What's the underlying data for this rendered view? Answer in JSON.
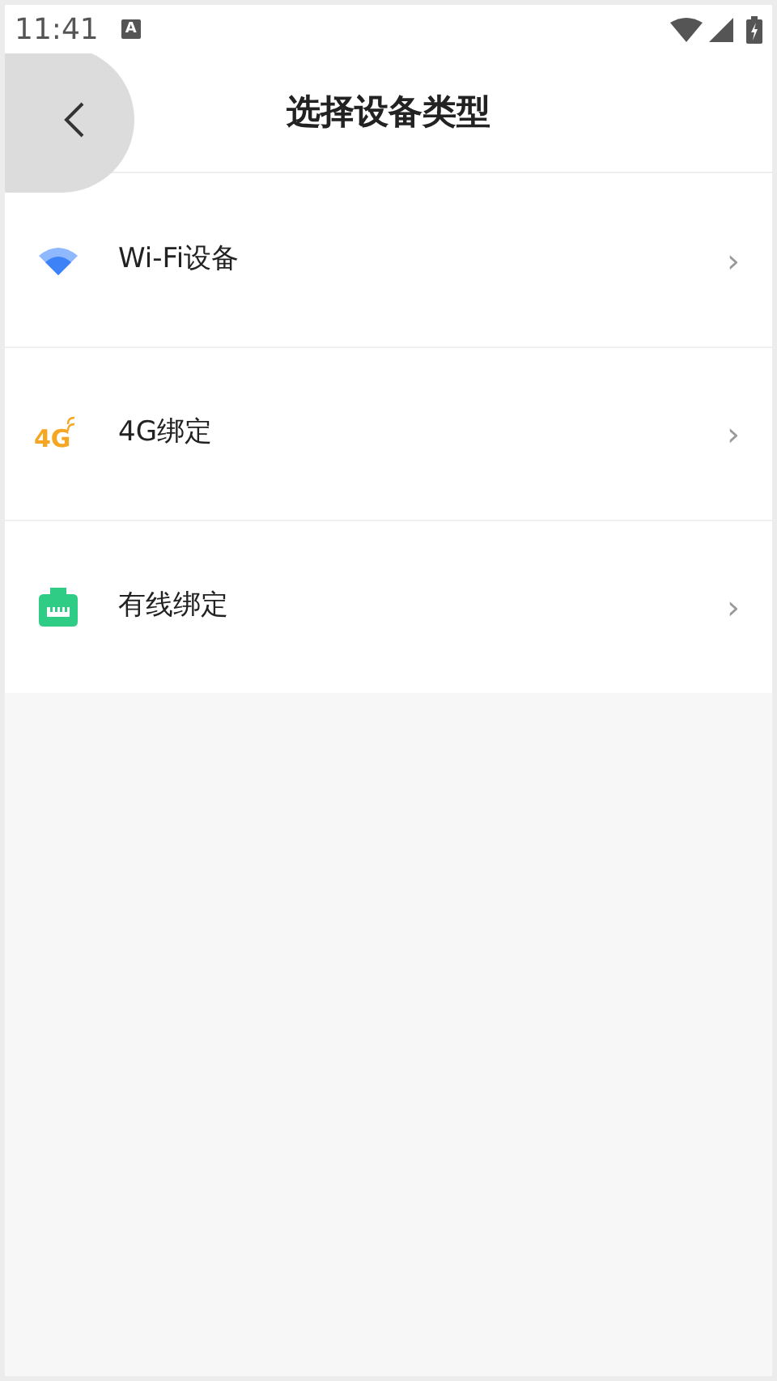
{
  "status_bar": {
    "time": "11:41",
    "notification_icon_text": "A"
  },
  "header": {
    "title": "选择设备类型"
  },
  "items": [
    {
      "kind": "wifi",
      "label": "Wi-Fi设备",
      "chevron": "›"
    },
    {
      "kind": "cellular",
      "label": "4G绑定",
      "icon_text": "4G",
      "chevron": "›"
    },
    {
      "kind": "wired",
      "label": "有线绑定",
      "chevron": "›"
    }
  ]
}
